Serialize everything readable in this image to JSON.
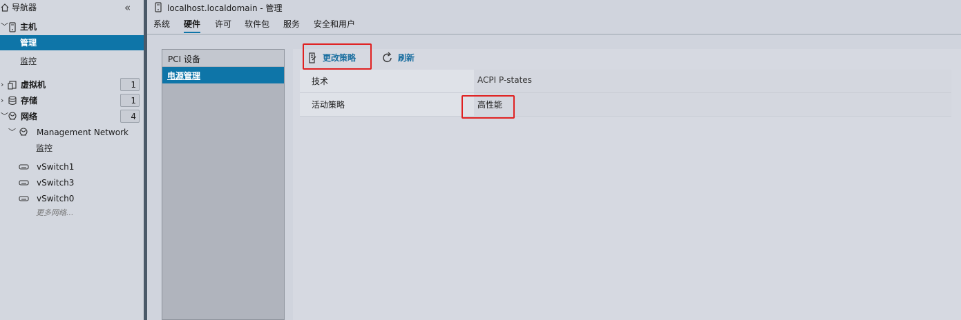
{
  "navigator": {
    "title": "导航器",
    "collapse_glyph": "«",
    "host": {
      "label": "主机",
      "children": [
        "管理",
        "监控"
      ]
    },
    "vm": {
      "label": "虚拟机",
      "count": "1"
    },
    "storage": {
      "label": "存储",
      "count": "1"
    },
    "network": {
      "label": "网络",
      "count": "4"
    },
    "mgmt_network": {
      "label": "Management Network",
      "child": "监控"
    },
    "switches": [
      "vSwitch1",
      "vSwitch3",
      "vSwitch0"
    ],
    "more": "更多网络..."
  },
  "window": {
    "title": "localhost.localdomain - 管理"
  },
  "tabs": [
    "系统",
    "硬件",
    "许可",
    "软件包",
    "服务",
    "安全和用户"
  ],
  "active_tab": "硬件",
  "sublist": {
    "items": [
      "PCI 设备",
      "电源管理"
    ],
    "selected": "电源管理"
  },
  "toolbar": {
    "change_policy": "更改策略",
    "refresh": "刷新"
  },
  "properties": [
    {
      "key": "技术",
      "value": "ACPI P-states"
    },
    {
      "key": "活动策略",
      "value": "高性能"
    }
  ],
  "colors": {
    "accent": "#0e75a8",
    "highlight_box": "#e02020"
  },
  "icons": [
    "home-icon",
    "server-icon",
    "vm-icon",
    "storage-icon",
    "network-icon",
    "switch-icon",
    "policy-icon",
    "refresh-icon"
  ]
}
